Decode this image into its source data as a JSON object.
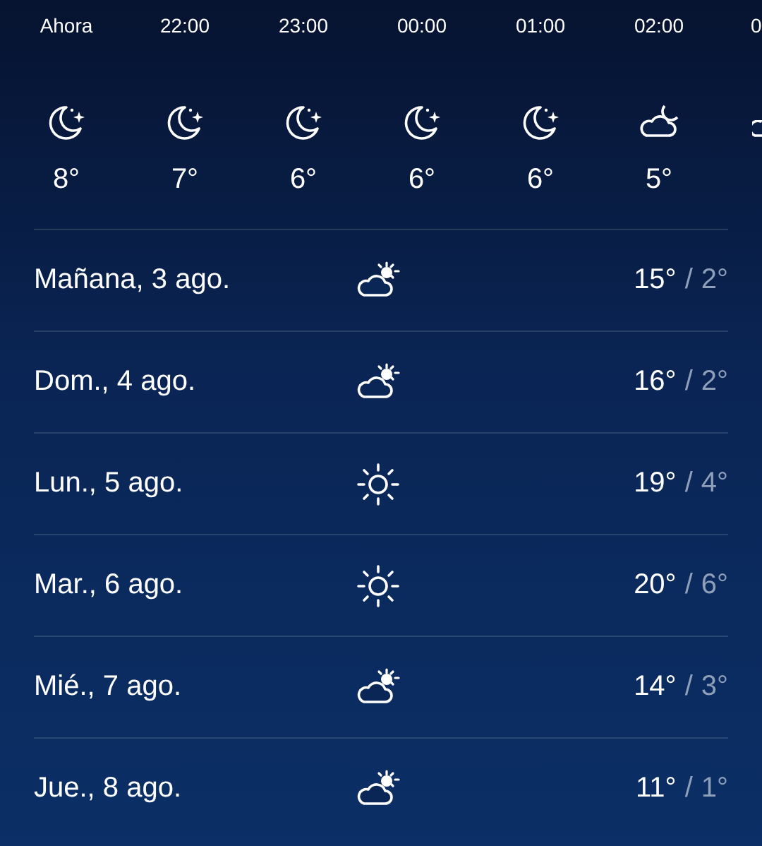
{
  "hourly": [
    {
      "time": "Ahora",
      "kind": "night",
      "temp": "8°"
    },
    {
      "time": "22:00",
      "kind": "night",
      "temp": "7°"
    },
    {
      "time": "23:00",
      "kind": "night",
      "temp": "6°"
    },
    {
      "time": "00:00",
      "kind": "night",
      "temp": "6°"
    },
    {
      "time": "01:00",
      "kind": "night",
      "temp": "6°"
    },
    {
      "time": "02:00",
      "kind": "cloudy",
      "temp": "5°"
    },
    {
      "time": "0",
      "kind": "cloudy"
    }
  ],
  "daily": [
    {
      "day": "Mañana, 3 ago.",
      "kind": "cloudy",
      "high": "15°",
      "separator": "/",
      "low": "2°"
    },
    {
      "day": "Dom., 4 ago.",
      "kind": "cloudy",
      "high": "16°",
      "separator": "/",
      "low": "2°"
    },
    {
      "day": "Lun., 5 ago.",
      "kind": "sunny",
      "high": "19°",
      "separator": "/",
      "low": "4°"
    },
    {
      "day": "Mar., 6 ago.",
      "kind": "sunny",
      "high": "20°",
      "separator": "/",
      "low": "6°"
    },
    {
      "day": "Mié., 7 ago.",
      "kind": "cloudy",
      "high": "14°",
      "separator": "/",
      "low": "3°"
    },
    {
      "day": "Jue., 8 ago.",
      "kind": "cloudy",
      "high": "11°",
      "separator": "/",
      "low": "1°"
    }
  ]
}
